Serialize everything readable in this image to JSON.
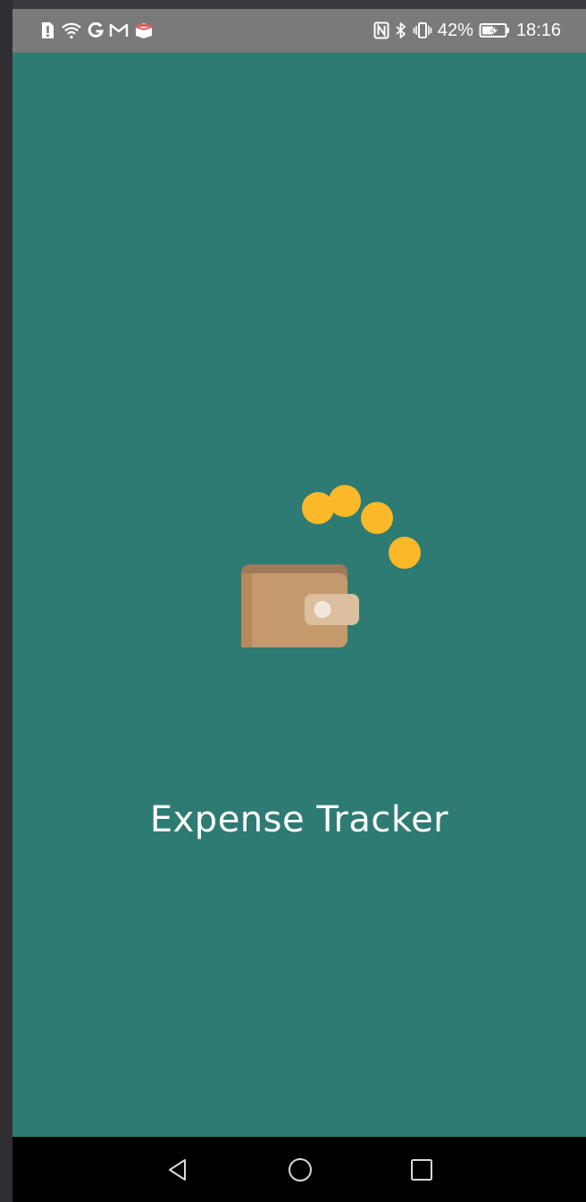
{
  "status_bar": {
    "battery_percent": "42%",
    "time": "18:16",
    "left_icons": [
      "alert-icon",
      "wifi-icon",
      "google-icon",
      "gmail-icon",
      "calendar-icon"
    ],
    "right_icons": [
      "nfc-icon",
      "bluetooth-icon",
      "vibrate-icon",
      "battery-charging-icon"
    ]
  },
  "app": {
    "title": "Expense Tracker",
    "background_color": "#2e7b73",
    "logo": "wallet-with-coins-icon",
    "coin_color": "#fbb829",
    "wallet_color": "#c49a6c"
  },
  "nav_bar": {
    "buttons": [
      "back-icon",
      "home-icon",
      "recents-icon"
    ]
  }
}
